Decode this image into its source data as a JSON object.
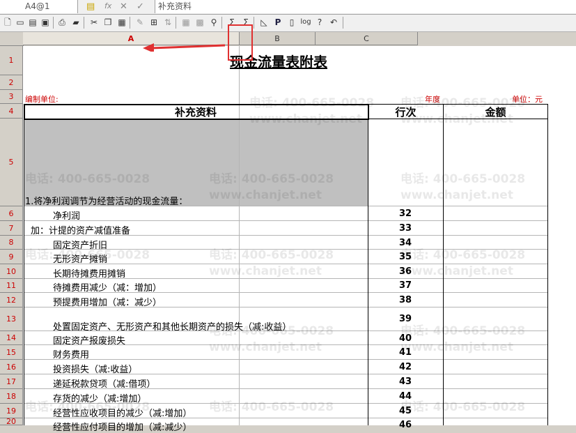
{
  "formula_bar": {
    "cell_ref": "A4@1",
    "value": "补充资料"
  },
  "columns": [
    "A",
    "B",
    "C"
  ],
  "row_numbers": [
    "1",
    "2",
    "3",
    "4",
    "5",
    "6",
    "7",
    "8",
    "9",
    "10",
    "11",
    "12",
    "13",
    "14",
    "15",
    "16",
    "17",
    "18",
    "19",
    "20"
  ],
  "sheet": {
    "title": "现金流量表附表",
    "org_label": "编制单位:",
    "year_label": "年度",
    "unit_label": "单位：元",
    "headers": {
      "col_a": "补充资料",
      "col_row": "行次",
      "col_amount": "金额"
    },
    "section1": "1.将净利润调节为经营活动的现金流量：",
    "rows": [
      {
        "label": "净利润",
        "num": "32"
      },
      {
        "label": "加：计提的资产减值准备",
        "num": "33"
      },
      {
        "label": "固定资产折旧",
        "num": "34"
      },
      {
        "label": "无形资产摊销",
        "num": "35"
      },
      {
        "label": "长期待摊费用摊销",
        "num": "36"
      },
      {
        "label": "待摊费用减少（减：增加）",
        "num": "37"
      },
      {
        "label": "预提费用增加（减：减少）",
        "num": "38"
      },
      {
        "label": "处置固定资产、无形资产和其他长期资产的损失（减:收益）",
        "num": "39"
      },
      {
        "label": "固定资产报废损失",
        "num": "40"
      },
      {
        "label": "财务费用",
        "num": "41"
      },
      {
        "label": "投资损失（减:收益）",
        "num": "42"
      },
      {
        "label": "递延税款贷项（减:借项）",
        "num": "43"
      },
      {
        "label": "存货的减少（减:增加）",
        "num": "44"
      },
      {
        "label": "经营性应收项目的减少（减:增加）",
        "num": "45"
      },
      {
        "label": "经营性应付项目的增加（减:减少）",
        "num": "46"
      }
    ]
  },
  "watermarks": {
    "phone": "电话: 400-665-0028",
    "site_prefix": "网址:",
    "site": "www.chanjet.net"
  },
  "colors": {
    "accent_red": "#e03030",
    "header_gray": "#d4d0c8"
  }
}
